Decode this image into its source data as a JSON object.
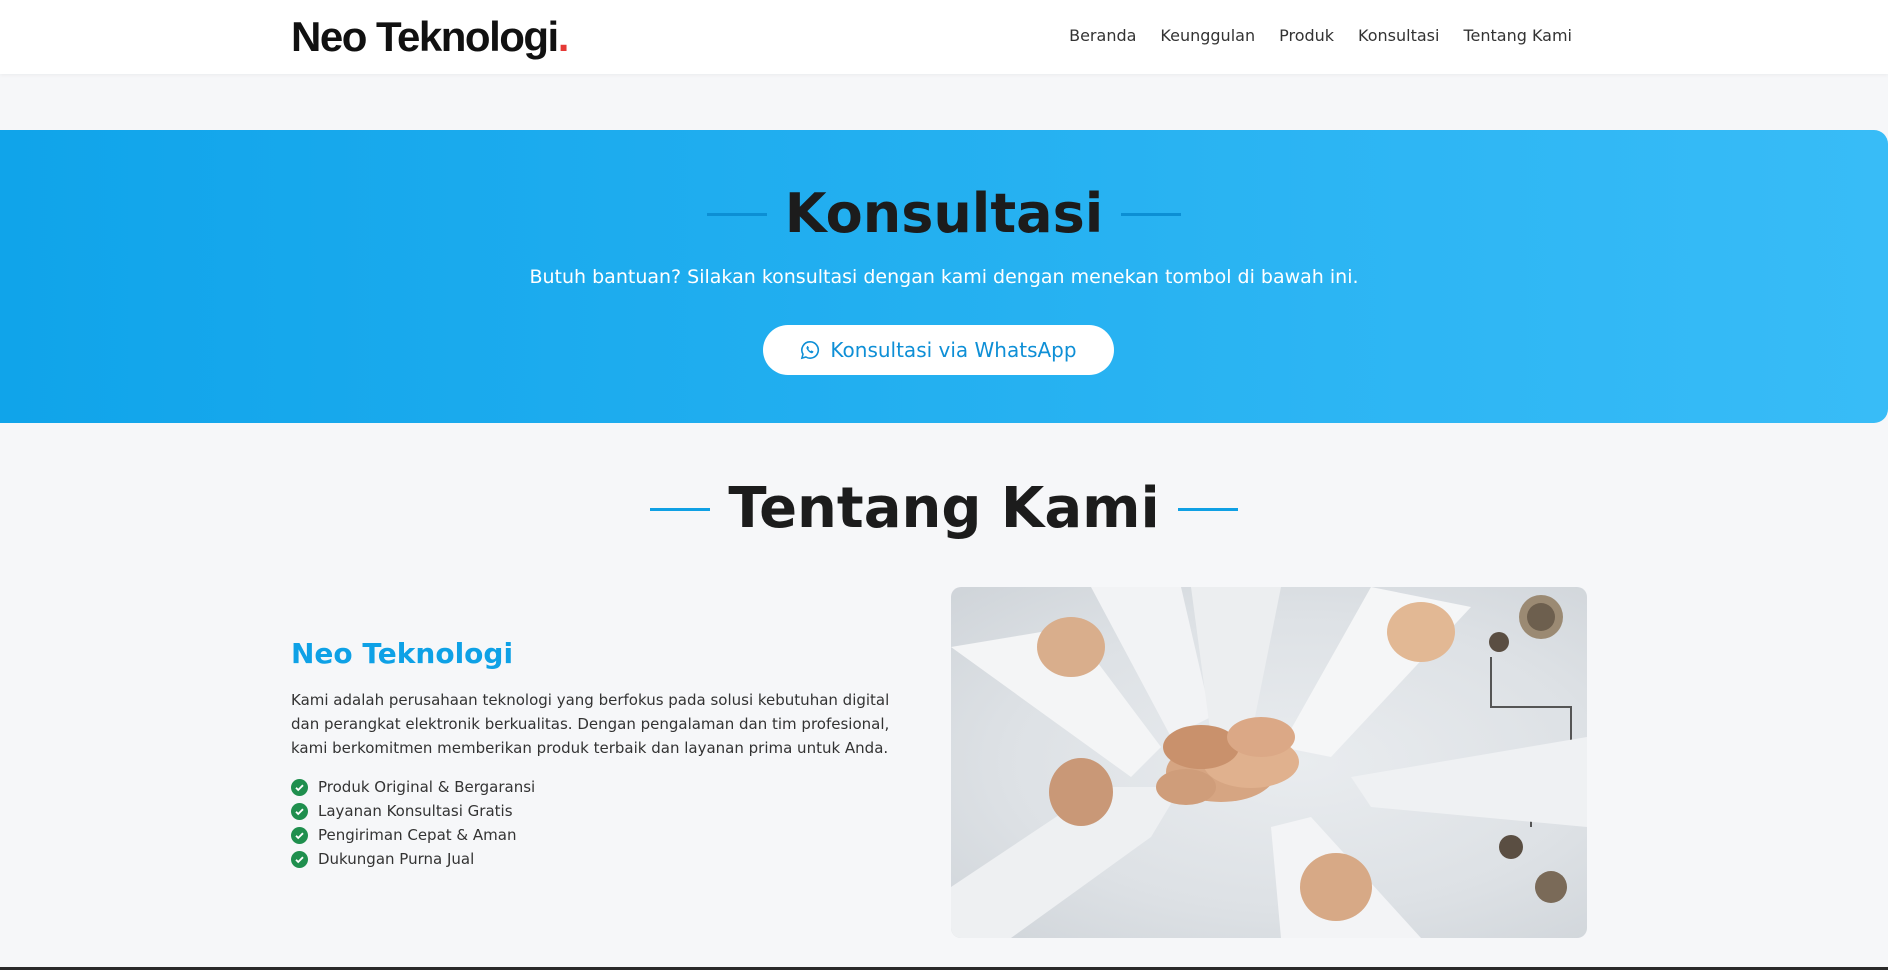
{
  "brand": {
    "name": "Neo Teknologi",
    "dot": ".",
    "accent_color": "#e53935"
  },
  "nav": {
    "items": [
      {
        "label": "Beranda"
      },
      {
        "label": "Keunggulan"
      },
      {
        "label": "Produk"
      },
      {
        "label": "Konsultasi"
      },
      {
        "label": "Tentang Kami"
      }
    ]
  },
  "hero": {
    "title": "Konsultasi",
    "subtitle": "Butuh bantuan? Silakan konsultasi dengan kami dengan menekan tombol di bawah ini.",
    "button_label": "Konsultasi via WhatsApp",
    "button_icon": "whatsapp-icon",
    "gradient_start": "#10a4ea",
    "gradient_end": "#38bcf7"
  },
  "about": {
    "title": "Tentang Kami",
    "company_name": "Neo Teknologi",
    "description": "Kami adalah perusahaan teknologi yang berfokus pada solusi kebutuhan digital dan perangkat elektronik berkualitas. Dengan pengalaman dan tim profesional, kami berkomitmen memberikan produk terbaik dan layanan prima untuk Anda.",
    "features": [
      {
        "label": "Produk Original & Bergaransi",
        "icon": "check-circle-icon"
      },
      {
        "label": "Layanan Konsultasi Gratis",
        "icon": "check-circle-icon"
      },
      {
        "label": "Pengiriman Cepat & Aman",
        "icon": "check-circle-icon"
      },
      {
        "label": "Dukungan Purna Jual",
        "icon": "check-circle-icon"
      }
    ],
    "accent_color": "#0ea1e6",
    "check_color": "#1f8f4e"
  }
}
